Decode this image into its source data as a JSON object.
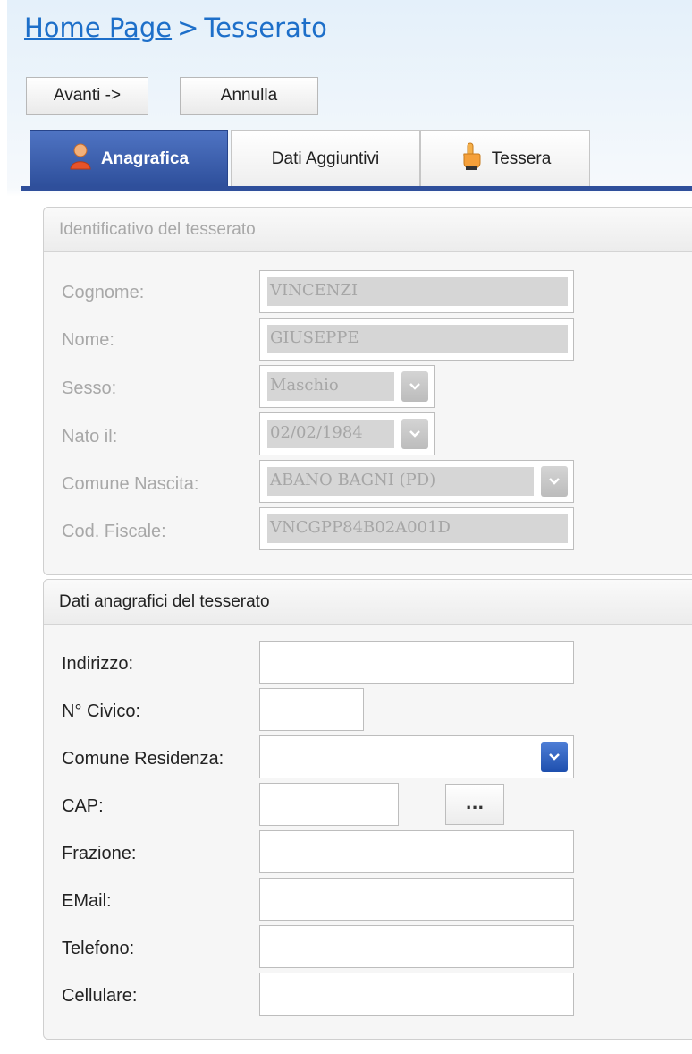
{
  "breadcrumb": {
    "home": "Home Page",
    "separator": ">",
    "current": "Tesserato"
  },
  "toolbar": {
    "next_label": "Avanti ->",
    "cancel_label": "Annulla"
  },
  "tabs": [
    {
      "label": "Anagrafica",
      "icon": "user-icon",
      "active": true
    },
    {
      "label": "Dati Aggiuntivi",
      "active": false
    },
    {
      "label": "Tessera",
      "icon": "pointing-hand-icon",
      "active": false
    }
  ],
  "identification": {
    "title": "Identificativo del tesserato",
    "cognome": {
      "label": "Cognome:",
      "value": "VINCENZI"
    },
    "nome": {
      "label": "Nome:",
      "value": "GIUSEPPE"
    },
    "sesso": {
      "label": "Sesso:",
      "value": "Maschio"
    },
    "nato_il": {
      "label": "Nato il:",
      "value": "02/02/1984"
    },
    "comune_nascita": {
      "label": "Comune Nascita:",
      "value": "ABANO BAGNI (PD)"
    },
    "cod_fiscale": {
      "label": "Cod. Fiscale:",
      "value": "VNCGPP84B02A001D"
    }
  },
  "registry": {
    "title": "Dati anagrafici del tesserato",
    "indirizzo": {
      "label": "Indirizzo:",
      "value": ""
    },
    "civico": {
      "label": "N° Civico:",
      "value": ""
    },
    "comune_residenza": {
      "label": "Comune Residenza:",
      "value": ""
    },
    "cap": {
      "label": "CAP:",
      "value": "",
      "lookup_label": "..."
    },
    "frazione": {
      "label": "Frazione:",
      "value": ""
    },
    "email": {
      "label": "EMail:",
      "value": ""
    },
    "telefono": {
      "label": "Telefono:",
      "value": ""
    },
    "cellulare": {
      "label": "Cellulare:",
      "value": ""
    }
  },
  "colors": {
    "link": "#1d6fc9",
    "active_tab": "#2f4f9b",
    "disabled_text": "#a8a8a8",
    "dropdown_enabled": "#2f5fbf"
  }
}
